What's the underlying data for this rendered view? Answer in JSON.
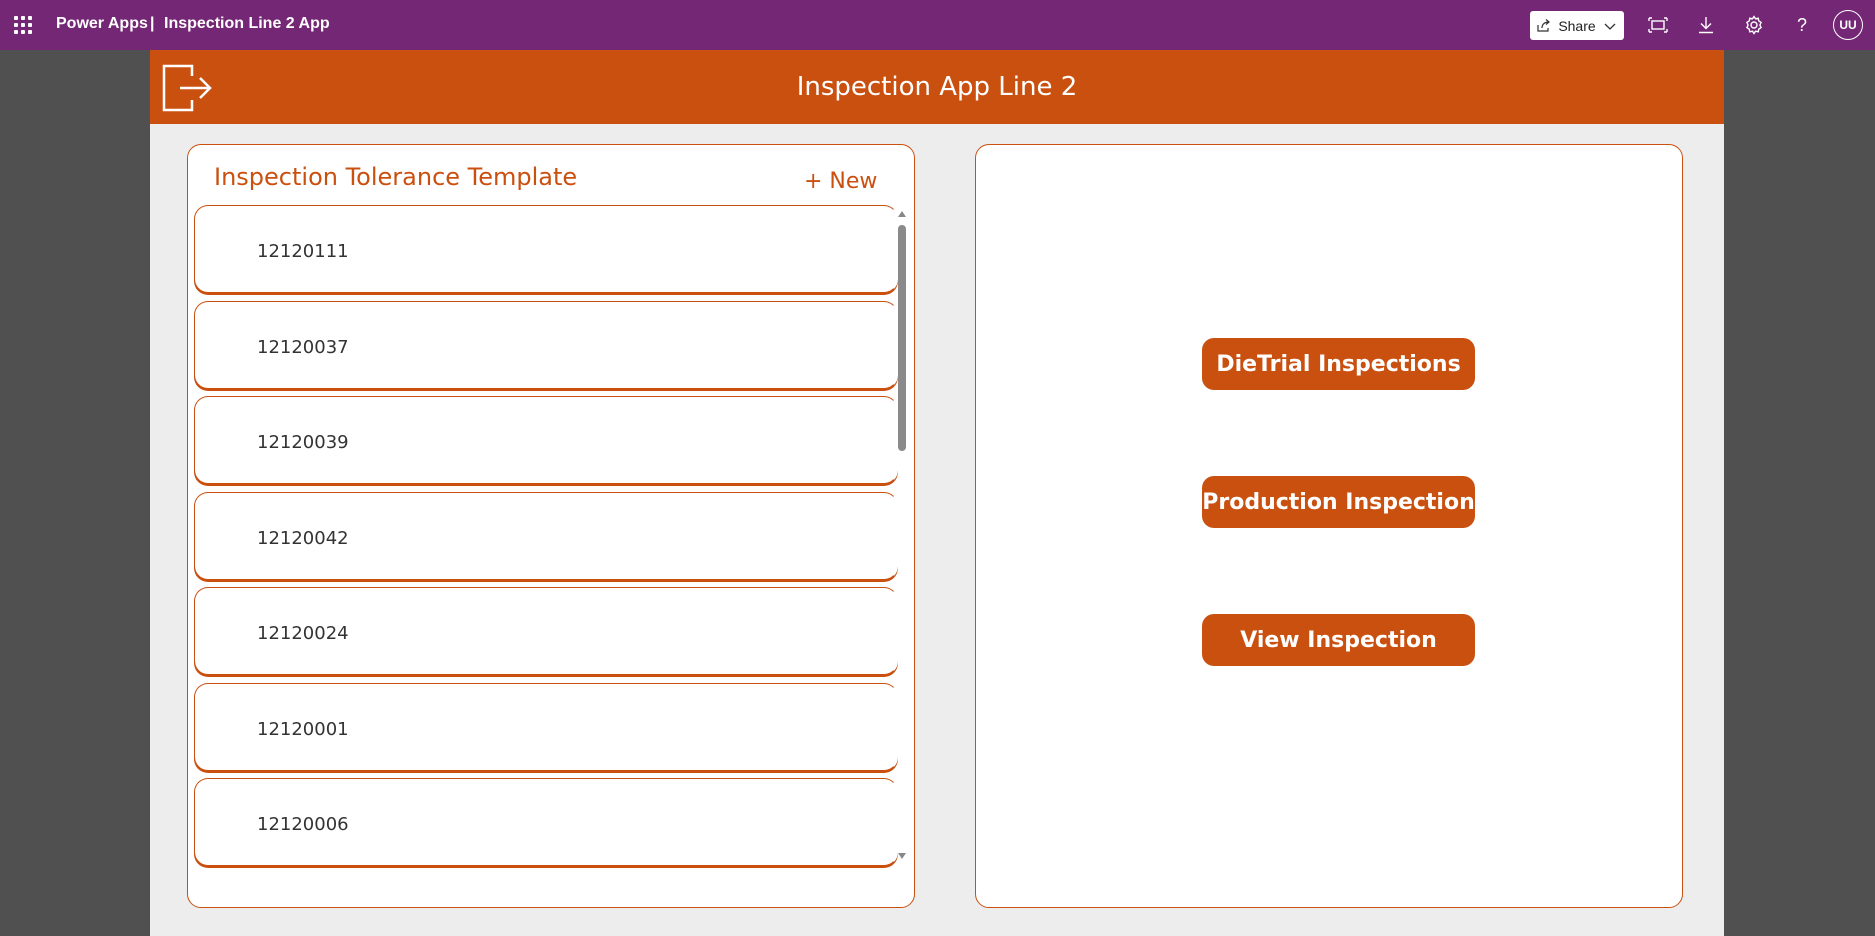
{
  "topbar": {
    "app_name": "Power Apps",
    "separator": "|",
    "app_title": "Inspection Line 2 App",
    "share_label": "Share",
    "avatar_initials": "UU",
    "icons": [
      "waffle-icon",
      "share-icon",
      "chevron-down-icon",
      "fit-screen-icon",
      "download-icon",
      "gear-icon",
      "help-icon"
    ]
  },
  "header": {
    "title": "Inspection App Line 2",
    "exit_icon": "exit-icon"
  },
  "left_panel": {
    "title": "Inspection Tolerance Template",
    "new_label": "+ New",
    "items": [
      {
        "label": "12120111"
      },
      {
        "label": "12120037"
      },
      {
        "label": "12120039"
      },
      {
        "label": "12120042"
      },
      {
        "label": "12120024"
      },
      {
        "label": "12120001"
      },
      {
        "label": "12120006"
      }
    ]
  },
  "right_panel": {
    "buttons": [
      {
        "label": "DieTrial Inspections"
      },
      {
        "label": "Production Inspection"
      },
      {
        "label": "View Inspection"
      }
    ]
  },
  "colors": {
    "topbar": "#742774",
    "accent": "#ca5010",
    "canvas_bg": "#ededed",
    "outer_bg": "#505050"
  }
}
